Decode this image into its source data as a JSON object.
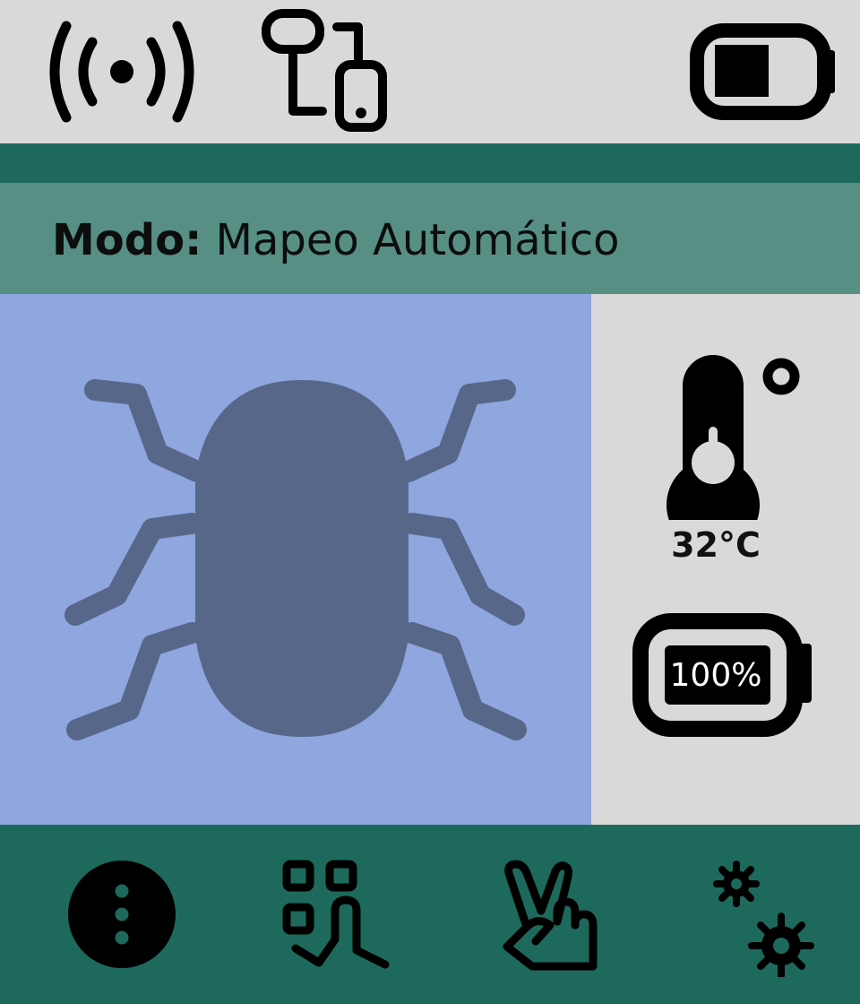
{
  "status_bar": {
    "icons": [
      "broadcast-signal-icon",
      "device-link-icon",
      "battery-status-icon"
    ]
  },
  "mode": {
    "label": "Modo:",
    "value": "Mapeo Automático"
  },
  "main": {
    "icon": "bug-icon",
    "icon_color": "#56678a",
    "background": "#8fa6de"
  },
  "side": {
    "temperature_icon": "thermometer-icon",
    "temperature": "32°C",
    "battery_icon": "battery-icon",
    "battery": "100%"
  },
  "nav": {
    "items": [
      {
        "name": "menu",
        "icon": "more-vertical-icon"
      },
      {
        "name": "qr-touch",
        "icon": "qr-touch-icon"
      },
      {
        "name": "gesture",
        "icon": "victory-hand-icon"
      },
      {
        "name": "settings",
        "icon": "gears-icon"
      }
    ]
  },
  "colors": {
    "dark_teal": "#1d6a5c",
    "mid_teal": "#578f85",
    "light_gray": "#d9d9d9",
    "blue_panel": "#8fa6de",
    "bug": "#56678a"
  }
}
